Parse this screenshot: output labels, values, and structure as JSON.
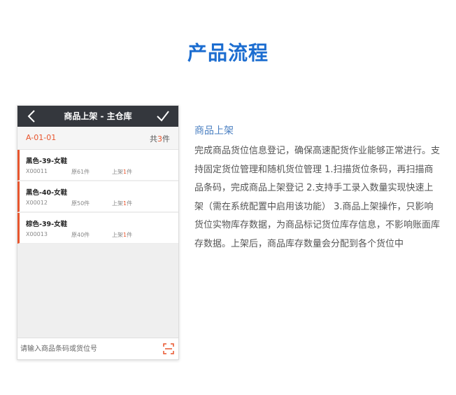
{
  "page": {
    "title": "产品流程"
  },
  "app": {
    "title": "商品上架 - 主仓库",
    "location": {
      "code": "A-01-01",
      "total_prefix": "共",
      "total_count": "3",
      "total_suffix": "件"
    },
    "items": [
      {
        "name": "黑色-39-女鞋",
        "sku": "X00011",
        "original": "原61件",
        "shelf_label": "上架",
        "shelf_count": "1",
        "shelf_unit": "件"
      },
      {
        "name": "黑色-40-女鞋",
        "sku": "X00012",
        "original": "原50件",
        "shelf_label": "上架",
        "shelf_count": "1",
        "shelf_unit": "件"
      },
      {
        "name": "棕色-39-女鞋",
        "sku": "X00013",
        "original": "原40件",
        "shelf_label": "上架",
        "shelf_count": "1",
        "shelf_unit": "件"
      }
    ],
    "search": {
      "placeholder": "请输入商品条码或货位号"
    },
    "icons": {
      "back": "chevron-left-icon",
      "confirm": "check-icon",
      "scan": "scan-icon"
    }
  },
  "description": {
    "title": "商品上架",
    "body": "完成商品货位信息登记，确保高速配货作业能够正常进行。支持固定货位管理和随机货位管理 1.扫描货位条码，再扫描商品条码，完成商品上架登记 2.支持手工录入数量实现快速上架（需在系统配置中启用该功能） 3.商品上架操作，只影响货位实物库存数据，为商品标记货位库存信息，不影响账面库存数据。上架后，商品库存数量会分配到各个货位中"
  },
  "colors": {
    "title_blue": "#1c6dd0",
    "nav_bg": "#34373d",
    "accent_orange": "#e8552d",
    "desc_title": "#4a7fc1"
  }
}
